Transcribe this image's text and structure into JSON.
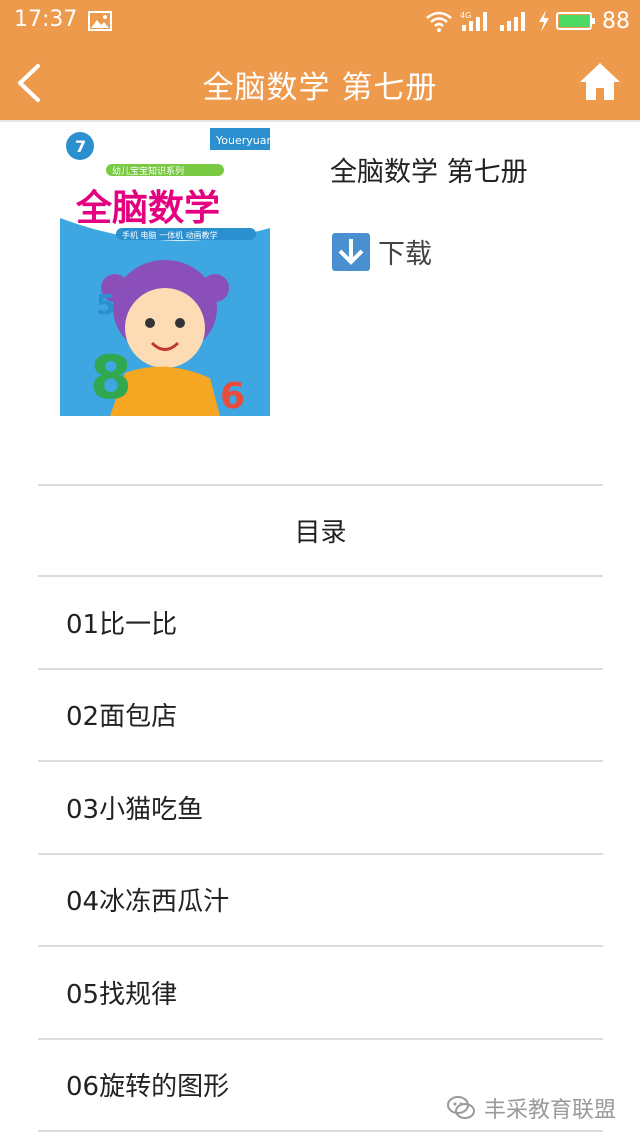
{
  "status_bar": {
    "time": "17:37",
    "battery": "88",
    "network": "4G"
  },
  "app_bar": {
    "title": "全脑数学 第七册"
  },
  "book": {
    "title": "全脑数学 第七册",
    "download_label": "下载",
    "cover": {
      "brand": "Youeryuan",
      "badge_number": "7",
      "title": "全脑数学",
      "series_banner": "幼儿宝宝知识系列",
      "features": "手机 电脑 一体机 动画教学",
      "numbers": [
        "5",
        "8",
        "6"
      ]
    }
  },
  "toc": {
    "header": "目录",
    "items": [
      "01比一比",
      "02面包店",
      "03小猫吃鱼",
      "04冰冻西瓜汁",
      "05找规律",
      "06旋转的图形"
    ]
  },
  "watermark": {
    "label": "丰采教育联盟"
  },
  "colors": {
    "accent": "#ee9a4c",
    "download_icon": "#4a8fd0"
  }
}
